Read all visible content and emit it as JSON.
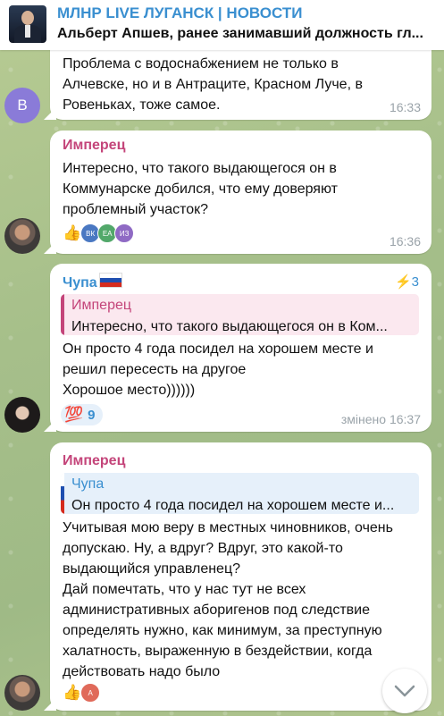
{
  "header": {
    "title": "МЛНР LIVE ЛУГАНСК | НОВОСТИ",
    "pinned": "Альберт Апшев, ранее занимавший должность гл..."
  },
  "messages": [
    {
      "avatar_letter": "B",
      "text": "Проблема с водоснабжением не только в\nАлчевске, но и в Антраците, Красном Луче, в\nРовеньках, тоже самое.",
      "time": "16:33"
    },
    {
      "sender": "Имперец",
      "text": "Интересно, что такого выдающегося он в\nКоммунарске добился, что ему доверяют\nпроблемный участок?",
      "time": "16:36",
      "reaction_emoji": "👍",
      "reaction_avatars": [
        "ВК",
        "ЕА",
        "ИЗ"
      ]
    },
    {
      "sender": "Чупа",
      "boost": "⚡3",
      "reply_name": "Имперец",
      "reply_text": "Интересно, что такого выдающегося он в Ком...",
      "text": "Он просто 4 года посидел на хорошем месте и\nрешил пересесть на другое\nХорошое место))))))",
      "reaction_emoji": "💯",
      "reaction_count": "9",
      "time": "змінено 16:37"
    },
    {
      "sender": "Имперец",
      "reply_name": "Чупа",
      "reply_text": "Он просто 4 года посидел на хорошем месте и...",
      "text": "Учитывая мою веру в местных чиновников, очень\nдопускаю. Ну, а вдруг? Вдруг, это какой-то\nвыдающийся управленец?\nДай помечтать, что у нас тут не всех\nадминистративных аборигенов под следствие\nопределять нужно, как минимум, за преступную\nхалатность, выраженную в бездействии, когда\nдействовать надо было",
      "reaction_emoji": "👍",
      "reaction_avatars": [
        "А"
      ]
    }
  ],
  "colors": {
    "accent": "#3a8fd0",
    "imperets": "#c4457a",
    "chupa": "#3a8fd0",
    "reply_pink_bg": "#fbe8ef",
    "reply_blue_bg": "#e6f0fa"
  }
}
